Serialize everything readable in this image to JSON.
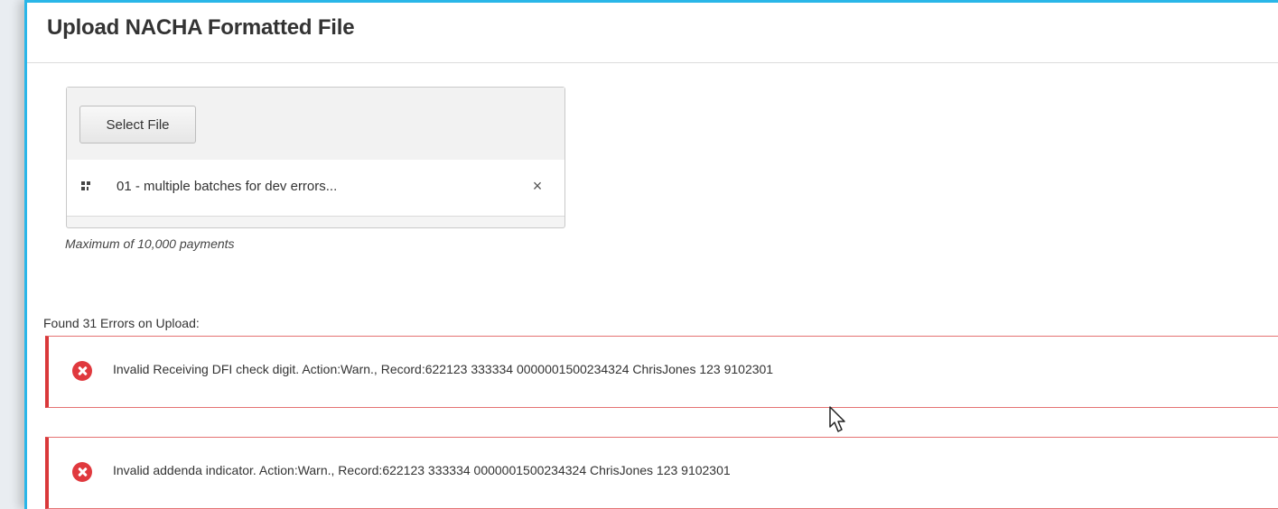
{
  "page": {
    "title": "Upload NACHA Formatted File"
  },
  "upload": {
    "select_button_label": "Select File",
    "file_name": "01 - multiple batches for dev errors...",
    "remove_symbol": "×",
    "max_note": "Maximum of 10,000 payments"
  },
  "errors": {
    "heading": "Found 31 Errors on Upload:",
    "items": [
      {
        "message": "Invalid Receiving DFI check digit. Action:Warn., Record:622123 333334 0000001500234324 ChrisJones 123 9102301"
      },
      {
        "message": "Invalid addenda indicator. Action:Warn., Record:622123 333334 0000001500234324 ChrisJones 123 9102301"
      }
    ]
  },
  "icons": {
    "drag": "drag-handle-icon",
    "remove": "close-icon",
    "error": "error-circle-icon",
    "cursor": "mouse-pointer-icon"
  },
  "colors": {
    "frame_accent": "#29b6e8",
    "error_border": "#d9383a",
    "error_icon": "#e0393e"
  }
}
